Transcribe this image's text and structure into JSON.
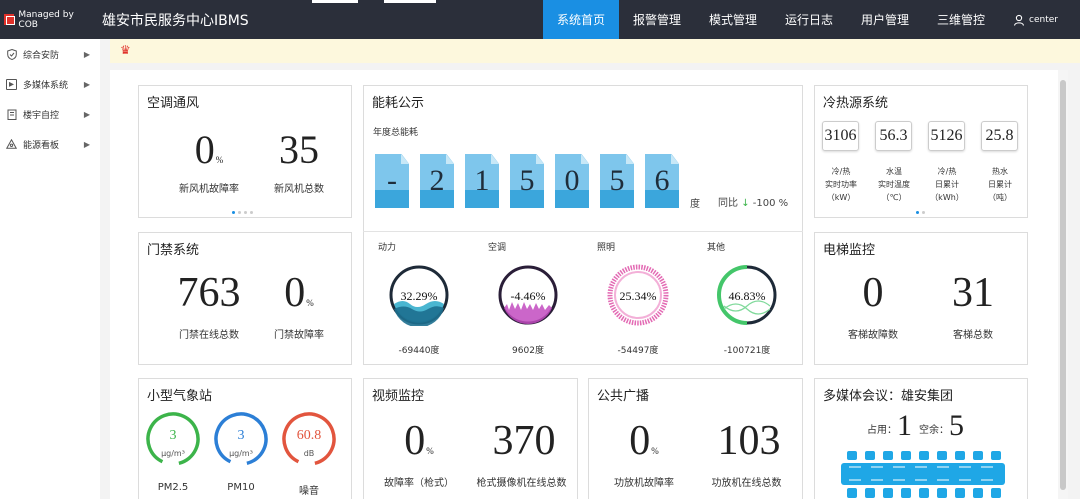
{
  "brand": {
    "managed_by": "Managed by COB"
  },
  "app_title": "雄安市民服务中心IBMS",
  "nav": [
    {
      "label": "系统首页",
      "active": true
    },
    {
      "label": "报警管理"
    },
    {
      "label": "模式管理"
    },
    {
      "label": "运行日志"
    },
    {
      "label": "用户管理"
    },
    {
      "label": "三维管控"
    }
  ],
  "user": {
    "name": "center",
    "icon": "user-icon"
  },
  "alert": {
    "icon": "bell-icon",
    "color": "#e0312a"
  },
  "sidebar": [
    {
      "label": "综合安防",
      "icon": "shield-icon"
    },
    {
      "label": "多媒体系统",
      "icon": "media-icon"
    },
    {
      "label": "楼宇自控",
      "icon": "building-icon"
    },
    {
      "label": "能源看板",
      "icon": "energy-icon"
    }
  ],
  "hvac": {
    "title": "空调通风",
    "fault_rate": "0",
    "fault_rate_unit": "%",
    "fault_rate_label": "新风机故障率",
    "total": "35",
    "total_label": "新风机总数"
  },
  "energy": {
    "title": "能耗公示",
    "annual_label": "年度总能耗",
    "digits": [
      "-",
      "2",
      "1",
      "5",
      "0",
      "5",
      "6"
    ],
    "unit": "度",
    "yoy_label": "同比",
    "yoy_value": "-100 %",
    "breakdown": [
      {
        "label": "动力",
        "percent": "32.29%",
        "value": "-69440度",
        "color": "#2aa9c9"
      },
      {
        "label": "空调",
        "percent": "-4.46%",
        "value": "9602度",
        "color": "#b23db0"
      },
      {
        "label": "照明",
        "percent": "25.34%",
        "value": "-54497度",
        "color": "#e36bb4"
      },
      {
        "label": "其他",
        "percent": "46.83%",
        "value": "-100721度",
        "color": "#44c66a"
      }
    ]
  },
  "heat": {
    "title": "冷热源系统",
    "stats": [
      {
        "value": "3106",
        "l1": "冷/热",
        "l2": "实时功率",
        "l3": "（kW）"
      },
      {
        "value": "56.3",
        "l1": "水温",
        "l2": "实时温度",
        "l3": "（℃）"
      },
      {
        "value": "5126",
        "l1": "冷/热",
        "l2": "日累计",
        "l3": "（kWh）"
      },
      {
        "value": "25.8",
        "l1": "热水",
        "l2": "日累计",
        "l3": "（吨）"
      }
    ]
  },
  "access": {
    "title": "门禁系统",
    "online": "763",
    "online_label": "门禁在线总数",
    "fault_rate": "0",
    "fault_rate_unit": "%",
    "fault_rate_label": "门禁故障率"
  },
  "elevator": {
    "title": "电梯监控",
    "fault": "0",
    "fault_label": "客梯故障数",
    "total": "31",
    "total_label": "客梯总数"
  },
  "weather": {
    "title": "小型气象站",
    "gauges": [
      {
        "value": "3",
        "unit": "μg/m³",
        "label": "PM2.5",
        "color": "#3cb44a"
      },
      {
        "value": "3",
        "unit": "μg/m³",
        "label": "PM10",
        "color": "#2c7fd6"
      },
      {
        "value": "60.8",
        "unit": "dB",
        "label": "噪音",
        "color": "#e2553e"
      }
    ]
  },
  "video": {
    "title": "视频监控",
    "fault_rate": "0",
    "fault_rate_unit": "%",
    "fault_rate_label": "故障率（枪式）",
    "online": "370",
    "online_label": "枪式摄像机在线总数"
  },
  "broadcast": {
    "title": "公共广播",
    "fault_rate": "0",
    "fault_rate_unit": "%",
    "fault_rate_label": "功放机故障率",
    "online": "103",
    "online_label": "功放机在线总数"
  },
  "meeting": {
    "title": "多媒体会议：雄安集团",
    "occupied_label": "占用：",
    "occupied": "1",
    "free_label": "空余：",
    "free": "5"
  }
}
